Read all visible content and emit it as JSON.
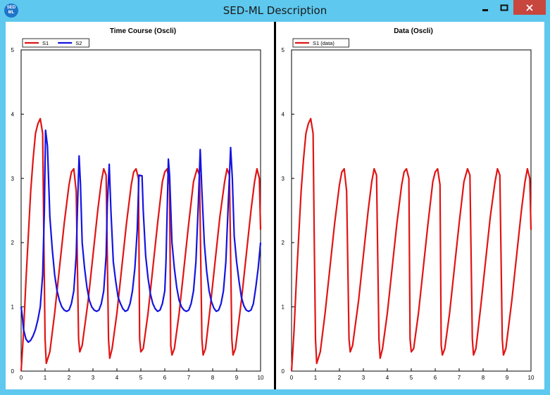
{
  "window": {
    "title": "SED-ML Description",
    "icon_text": [
      "SED",
      "ML"
    ],
    "icon": "sedml-logo-icon",
    "controls": {
      "minimize": "minimize-icon",
      "maximize": "maximize-icon",
      "close": "close-icon"
    },
    "colors": {
      "frame": "#5ec8ee",
      "close_button": "#c7463e",
      "icon": "#1f73c8"
    }
  },
  "chart_data": [
    {
      "type": "line",
      "title": "Time Course (Oscli)",
      "xlim": [
        0,
        10
      ],
      "ylim": [
        0,
        5
      ],
      "xticks": [
        "0",
        "1",
        "2",
        "3",
        "4",
        "5",
        "6",
        "7",
        "8",
        "9",
        "10"
      ],
      "yticks": [
        "0",
        "1",
        "2",
        "3",
        "4",
        "5"
      ],
      "legend": "top-left",
      "series": [
        {
          "name": "S1",
          "color": "#e11414",
          "points": [
            [
              0,
              0
            ],
            [
              0.1,
              0.6
            ],
            [
              0.2,
              1.4
            ],
            [
              0.3,
              2.1
            ],
            [
              0.4,
              2.8
            ],
            [
              0.5,
              3.3
            ],
            [
              0.6,
              3.7
            ],
            [
              0.7,
              3.85
            ],
            [
              0.8,
              3.93
            ],
            [
              0.9,
              3.7
            ],
            [
              0.95,
              2.0
            ],
            [
              1.0,
              0.5
            ],
            [
              1.05,
              0.12
            ],
            [
              1.2,
              0.3
            ],
            [
              1.4,
              0.9
            ],
            [
              1.6,
              1.6
            ],
            [
              1.8,
              2.3
            ],
            [
              2.0,
              2.9
            ],
            [
              2.1,
              3.1
            ],
            [
              2.2,
              3.15
            ],
            [
              2.3,
              2.8
            ],
            [
              2.4,
              0.5
            ],
            [
              2.45,
              0.3
            ],
            [
              2.55,
              0.4
            ],
            [
              2.8,
              1.1
            ],
            [
              3.0,
              1.8
            ],
            [
              3.2,
              2.5
            ],
            [
              3.35,
              2.95
            ],
            [
              3.45,
              3.15
            ],
            [
              3.55,
              3.05
            ],
            [
              3.65,
              0.5
            ],
            [
              3.7,
              0.2
            ],
            [
              3.8,
              0.35
            ],
            [
              4.0,
              0.9
            ],
            [
              4.2,
              1.6
            ],
            [
              4.4,
              2.3
            ],
            [
              4.6,
              2.9
            ],
            [
              4.7,
              3.1
            ],
            [
              4.8,
              3.15
            ],
            [
              4.9,
              3.0
            ],
            [
              4.95,
              0.5
            ],
            [
              5.0,
              0.3
            ],
            [
              5.1,
              0.35
            ],
            [
              5.3,
              0.9
            ],
            [
              5.5,
              1.6
            ],
            [
              5.7,
              2.3
            ],
            [
              5.9,
              2.95
            ],
            [
              6.0,
              3.1
            ],
            [
              6.1,
              3.15
            ],
            [
              6.2,
              2.9
            ],
            [
              6.25,
              0.4
            ],
            [
              6.3,
              0.25
            ],
            [
              6.4,
              0.35
            ],
            [
              6.6,
              0.9
            ],
            [
              6.8,
              1.6
            ],
            [
              7.0,
              2.3
            ],
            [
              7.2,
              2.95
            ],
            [
              7.35,
              3.15
            ],
            [
              7.45,
              3.05
            ],
            [
              7.55,
              0.5
            ],
            [
              7.6,
              0.25
            ],
            [
              7.7,
              0.35
            ],
            [
              7.9,
              1.0
            ],
            [
              8.1,
              1.7
            ],
            [
              8.3,
              2.4
            ],
            [
              8.5,
              2.95
            ],
            [
              8.6,
              3.15
            ],
            [
              8.7,
              3.05
            ],
            [
              8.8,
              0.5
            ],
            [
              8.85,
              0.25
            ],
            [
              8.95,
              0.35
            ],
            [
              9.2,
              1.1
            ],
            [
              9.4,
              1.8
            ],
            [
              9.6,
              2.5
            ],
            [
              9.75,
              2.95
            ],
            [
              9.85,
              3.15
            ],
            [
              9.95,
              3.0
            ],
            [
              10.0,
              2.2
            ]
          ]
        },
        {
          "name": "S2",
          "color": "#1414e1",
          "points": [
            [
              0,
              1.0
            ],
            [
              0.05,
              0.85
            ],
            [
              0.1,
              0.65
            ],
            [
              0.2,
              0.5
            ],
            [
              0.3,
              0.45
            ],
            [
              0.4,
              0.48
            ],
            [
              0.5,
              0.55
            ],
            [
              0.6,
              0.65
            ],
            [
              0.7,
              0.8
            ],
            [
              0.8,
              1.0
            ],
            [
              0.9,
              1.5
            ],
            [
              0.97,
              2.5
            ],
            [
              1.02,
              3.75
            ],
            [
              1.1,
              3.5
            ],
            [
              1.2,
              2.4
            ],
            [
              1.3,
              1.9
            ],
            [
              1.4,
              1.5
            ],
            [
              1.5,
              1.25
            ],
            [
              1.6,
              1.1
            ],
            [
              1.7,
              1.0
            ],
            [
              1.8,
              0.95
            ],
            [
              1.9,
              0.93
            ],
            [
              2.0,
              0.95
            ],
            [
              2.1,
              1.05
            ],
            [
              2.2,
              1.25
            ],
            [
              2.3,
              1.8
            ],
            [
              2.35,
              2.5
            ],
            [
              2.42,
              3.35
            ],
            [
              2.48,
              2.9
            ],
            [
              2.55,
              2.0
            ],
            [
              2.65,
              1.6
            ],
            [
              2.75,
              1.3
            ],
            [
              2.85,
              1.1
            ],
            [
              2.95,
              1.0
            ],
            [
              3.05,
              0.95
            ],
            [
              3.15,
              0.93
            ],
            [
              3.25,
              0.95
            ],
            [
              3.35,
              1.05
            ],
            [
              3.45,
              1.25
            ],
            [
              3.55,
              1.8
            ],
            [
              3.6,
              2.6
            ],
            [
              3.68,
              3.22
            ],
            [
              3.75,
              2.5
            ],
            [
              3.85,
              1.7
            ],
            [
              3.95,
              1.4
            ],
            [
              4.05,
              1.15
            ],
            [
              4.15,
              1.05
            ],
            [
              4.25,
              0.97
            ],
            [
              4.35,
              0.93
            ],
            [
              4.45,
              0.95
            ],
            [
              4.55,
              1.05
            ],
            [
              4.65,
              1.25
            ],
            [
              4.75,
              1.6
            ],
            [
              4.85,
              2.2
            ],
            [
              4.92,
              3.05
            ],
            [
              5.05,
              3.04
            ],
            [
              5.1,
              2.5
            ],
            [
              5.2,
              1.8
            ],
            [
              5.3,
              1.45
            ],
            [
              5.4,
              1.2
            ],
            [
              5.5,
              1.05
            ],
            [
              5.6,
              0.97
            ],
            [
              5.7,
              0.93
            ],
            [
              5.8,
              0.95
            ],
            [
              5.9,
              1.05
            ],
            [
              6.0,
              1.25
            ],
            [
              6.05,
              1.7
            ],
            [
              6.1,
              2.5
            ],
            [
              6.15,
              3.3
            ],
            [
              6.2,
              3.05
            ],
            [
              6.3,
              2.0
            ],
            [
              6.4,
              1.6
            ],
            [
              6.5,
              1.3
            ],
            [
              6.6,
              1.1
            ],
            [
              6.7,
              1.0
            ],
            [
              6.8,
              0.95
            ],
            [
              6.9,
              0.93
            ],
            [
              7.0,
              0.95
            ],
            [
              7.1,
              1.05
            ],
            [
              7.2,
              1.25
            ],
            [
              7.3,
              1.7
            ],
            [
              7.4,
              2.6
            ],
            [
              7.48,
              3.45
            ],
            [
              7.55,
              2.8
            ],
            [
              7.65,
              2.0
            ],
            [
              7.75,
              1.55
            ],
            [
              7.85,
              1.25
            ],
            [
              7.95,
              1.08
            ],
            [
              8.05,
              0.98
            ],
            [
              8.15,
              0.93
            ],
            [
              8.25,
              0.95
            ],
            [
              8.35,
              1.05
            ],
            [
              8.45,
              1.25
            ],
            [
              8.55,
              1.7
            ],
            [
              8.65,
              2.6
            ],
            [
              8.75,
              3.48
            ],
            [
              8.82,
              3.0
            ],
            [
              8.9,
              2.1
            ],
            [
              9.0,
              1.7
            ],
            [
              9.1,
              1.4
            ],
            [
              9.2,
              1.15
            ],
            [
              9.3,
              1.02
            ],
            [
              9.4,
              0.95
            ],
            [
              9.5,
              0.93
            ],
            [
              9.6,
              0.95
            ],
            [
              9.7,
              1.05
            ],
            [
              9.8,
              1.3
            ],
            [
              9.9,
              1.6
            ],
            [
              10.0,
              2.0
            ]
          ]
        }
      ]
    },
    {
      "type": "line",
      "title": "Data (Oscli)",
      "xlim": [
        0,
        10
      ],
      "ylim": [
        0,
        5
      ],
      "xticks": [
        "0",
        "1",
        "2",
        "3",
        "4",
        "5",
        "6",
        "7",
        "8",
        "9",
        "10"
      ],
      "yticks": [
        "0",
        "1",
        "2",
        "3",
        "4",
        "5"
      ],
      "legend": "top-left",
      "series": [
        {
          "name": "S1 (data)",
          "color": "#e11414",
          "points": [
            [
              0,
              0
            ],
            [
              0.1,
              0.6
            ],
            [
              0.2,
              1.4
            ],
            [
              0.3,
              2.1
            ],
            [
              0.4,
              2.8
            ],
            [
              0.5,
              3.3
            ],
            [
              0.6,
              3.7
            ],
            [
              0.7,
              3.85
            ],
            [
              0.8,
              3.93
            ],
            [
              0.9,
              3.7
            ],
            [
              0.95,
              2.0
            ],
            [
              1.0,
              0.5
            ],
            [
              1.05,
              0.12
            ],
            [
              1.2,
              0.3
            ],
            [
              1.4,
              0.9
            ],
            [
              1.6,
              1.6
            ],
            [
              1.8,
              2.3
            ],
            [
              2.0,
              2.9
            ],
            [
              2.1,
              3.1
            ],
            [
              2.2,
              3.15
            ],
            [
              2.3,
              2.8
            ],
            [
              2.4,
              0.5
            ],
            [
              2.45,
              0.3
            ],
            [
              2.55,
              0.4
            ],
            [
              2.8,
              1.1
            ],
            [
              3.0,
              1.8
            ],
            [
              3.2,
              2.5
            ],
            [
              3.35,
              2.95
            ],
            [
              3.45,
              3.15
            ],
            [
              3.55,
              3.05
            ],
            [
              3.65,
              0.5
            ],
            [
              3.7,
              0.2
            ],
            [
              3.8,
              0.35
            ],
            [
              4.0,
              0.9
            ],
            [
              4.2,
              1.6
            ],
            [
              4.4,
              2.3
            ],
            [
              4.6,
              2.9
            ],
            [
              4.7,
              3.1
            ],
            [
              4.8,
              3.15
            ],
            [
              4.9,
              3.0
            ],
            [
              4.95,
              0.5
            ],
            [
              5.0,
              0.3
            ],
            [
              5.1,
              0.35
            ],
            [
              5.3,
              0.9
            ],
            [
              5.5,
              1.6
            ],
            [
              5.7,
              2.3
            ],
            [
              5.9,
              2.95
            ],
            [
              6.0,
              3.1
            ],
            [
              6.1,
              3.15
            ],
            [
              6.2,
              2.9
            ],
            [
              6.25,
              0.4
            ],
            [
              6.3,
              0.25
            ],
            [
              6.4,
              0.35
            ],
            [
              6.6,
              0.9
            ],
            [
              6.8,
              1.6
            ],
            [
              7.0,
              2.3
            ],
            [
              7.2,
              2.95
            ],
            [
              7.35,
              3.15
            ],
            [
              7.45,
              3.05
            ],
            [
              7.55,
              0.5
            ],
            [
              7.6,
              0.25
            ],
            [
              7.7,
              0.35
            ],
            [
              7.9,
              1.0
            ],
            [
              8.1,
              1.7
            ],
            [
              8.3,
              2.4
            ],
            [
              8.5,
              2.95
            ],
            [
              8.6,
              3.15
            ],
            [
              8.7,
              3.05
            ],
            [
              8.8,
              0.5
            ],
            [
              8.85,
              0.25
            ],
            [
              8.95,
              0.35
            ],
            [
              9.2,
              1.1
            ],
            [
              9.4,
              1.8
            ],
            [
              9.6,
              2.5
            ],
            [
              9.75,
              2.95
            ],
            [
              9.85,
              3.15
            ],
            [
              9.95,
              3.0
            ],
            [
              10.0,
              2.2
            ]
          ]
        }
      ]
    }
  ]
}
